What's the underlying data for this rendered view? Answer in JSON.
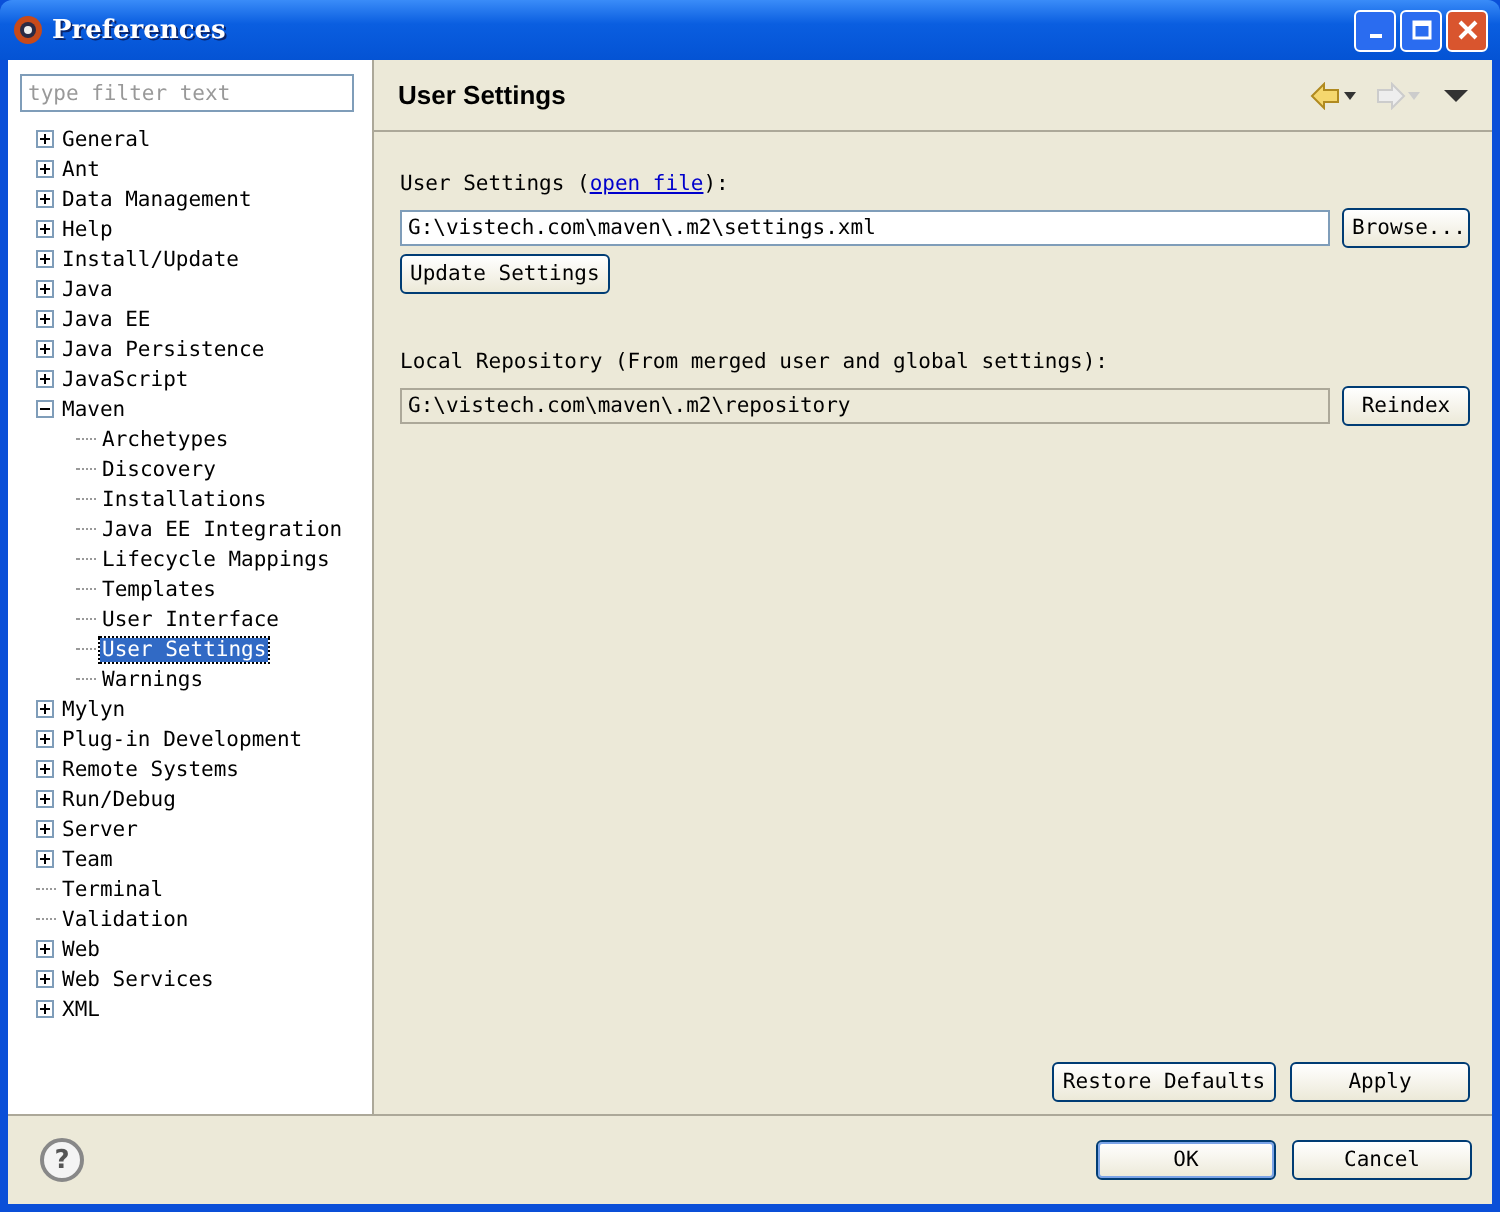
{
  "window": {
    "title": "Preferences"
  },
  "filter": {
    "placeholder": "type filter text"
  },
  "tree": [
    {
      "label": "General",
      "expanded": false,
      "selected": false
    },
    {
      "label": "Ant",
      "expanded": false,
      "selected": false
    },
    {
      "label": "Data Management",
      "expanded": false,
      "selected": false
    },
    {
      "label": "Help",
      "expanded": false,
      "selected": false
    },
    {
      "label": "Install/Update",
      "expanded": false,
      "selected": false
    },
    {
      "label": "Java",
      "expanded": false,
      "selected": false
    },
    {
      "label": "Java EE",
      "expanded": false,
      "selected": false
    },
    {
      "label": "Java Persistence",
      "expanded": false,
      "selected": false
    },
    {
      "label": "JavaScript",
      "expanded": false,
      "selected": false
    },
    {
      "label": "Maven",
      "expanded": true,
      "selected": false,
      "children": [
        {
          "label": "Archetypes",
          "selected": false
        },
        {
          "label": "Discovery",
          "selected": false
        },
        {
          "label": "Installations",
          "selected": false
        },
        {
          "label": "Java EE Integration",
          "selected": false
        },
        {
          "label": "Lifecycle Mappings",
          "selected": false
        },
        {
          "label": "Templates",
          "selected": false
        },
        {
          "label": "User Interface",
          "selected": false
        },
        {
          "label": "User Settings",
          "selected": true
        },
        {
          "label": "Warnings",
          "selected": false
        }
      ]
    },
    {
      "label": "Mylyn",
      "expanded": false,
      "selected": false
    },
    {
      "label": "Plug-in Development",
      "expanded": false,
      "selected": false
    },
    {
      "label": "Remote Systems",
      "expanded": false,
      "selected": false
    },
    {
      "label": "Run/Debug",
      "expanded": false,
      "selected": false
    },
    {
      "label": "Server",
      "expanded": false,
      "selected": false
    },
    {
      "label": "Team",
      "expanded": false,
      "selected": false
    },
    {
      "label": "Terminal",
      "selected": false
    },
    {
      "label": "Validation",
      "selected": false
    },
    {
      "label": "Web",
      "expanded": false,
      "selected": false
    },
    {
      "label": "Web Services",
      "expanded": false,
      "selected": false
    },
    {
      "label": "XML",
      "expanded": false,
      "selected": false
    }
  ],
  "page": {
    "title": "User Settings",
    "nav": [
      {
        "kind": "back",
        "disabled": false
      },
      {
        "kind": "forward",
        "disabled": true
      }
    ],
    "user_settings": {
      "label": "User Settings (",
      "link": "open file",
      "suffix": "):",
      "value": "G:\\vistech.com\\maven\\.m2\\settings.xml",
      "browse": "Browse...",
      "update": "Update Settings"
    },
    "local_repo": {
      "label": "Local Repository (From merged user and global settings):",
      "value": "G:\\vistech.com\\maven\\.m2\\repository",
      "reindex": "Reindex"
    },
    "restore": "Restore Defaults",
    "apply": "Apply"
  },
  "footer": {
    "help": "?",
    "ok": "OK",
    "cancel": "Cancel"
  }
}
